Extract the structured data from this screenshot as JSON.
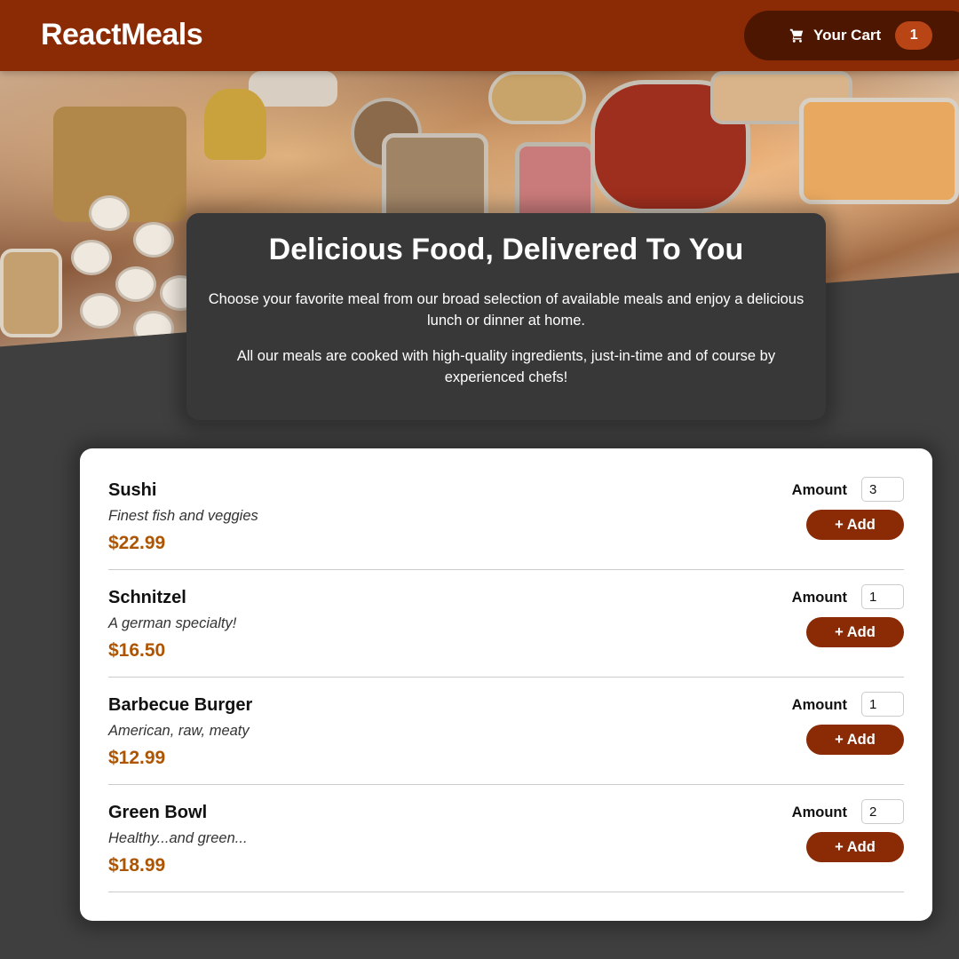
{
  "header": {
    "brand": "ReactMeals",
    "cart": {
      "label": "Your Cart",
      "count": "1",
      "icon": "cart-icon"
    }
  },
  "hero": {
    "image": "food-buffet-table"
  },
  "summary": {
    "title": "Delicious Food, Delivered To You",
    "paragraph1": "Choose your favorite meal from our broad selection of available meals and enjoy a delicious lunch or dinner at home.",
    "paragraph2": "All our meals are cooked with high-quality ingredients, just-in-time and of course by experienced chefs!"
  },
  "meals": [
    {
      "name": "Sushi",
      "description": "Finest fish and veggies",
      "price": "$22.99",
      "amount_label": "Amount",
      "amount": "3",
      "add_label": "+ Add"
    },
    {
      "name": "Schnitzel",
      "description": "A german specialty!",
      "price": "$16.50",
      "amount_label": "Amount",
      "amount": "1",
      "add_label": "+ Add"
    },
    {
      "name": "Barbecue Burger",
      "description": "American, raw, meaty",
      "price": "$12.99",
      "amount_label": "Amount",
      "amount": "1",
      "add_label": "+ Add"
    },
    {
      "name": "Green Bowl",
      "description": "Healthy...and green...",
      "price": "$18.99",
      "amount_label": "Amount",
      "amount": "2",
      "add_label": "+ Add"
    }
  ],
  "colors": {
    "header": "#8a2b06",
    "cart_button": "#4d1601",
    "badge": "#b94517",
    "price": "#ad5502",
    "background": "#3f3f3f"
  }
}
